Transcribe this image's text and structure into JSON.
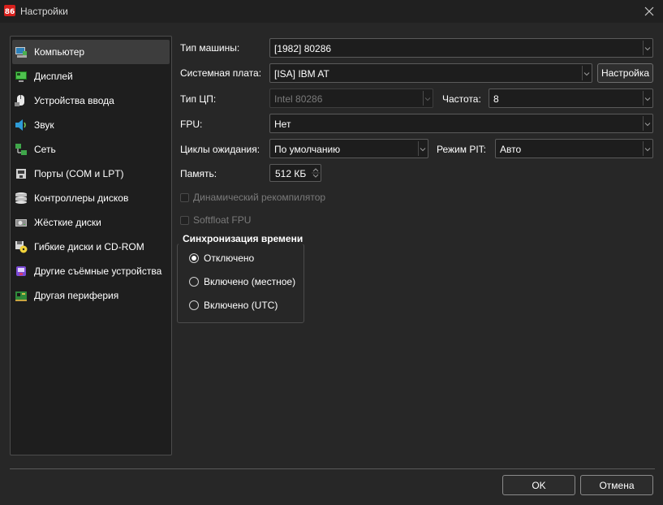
{
  "window": {
    "title": "Настройки",
    "app_icon": "86box-icon",
    "close_icon": "close-icon"
  },
  "sidebar": {
    "items": [
      {
        "label": "Компьютер",
        "icon": "computer-icon",
        "selected": true
      },
      {
        "label": "Дисплей",
        "icon": "display-icon"
      },
      {
        "label": "Устройства ввода",
        "icon": "input-devices-icon"
      },
      {
        "label": "Звук",
        "icon": "sound-icon"
      },
      {
        "label": "Сеть",
        "icon": "network-icon"
      },
      {
        "label": "Порты (COM и LPT)",
        "icon": "ports-icon"
      },
      {
        "label": "Контроллеры дисков",
        "icon": "storage-controllers-icon"
      },
      {
        "label": "Жёсткие диски",
        "icon": "hard-disk-icon"
      },
      {
        "label": "Гибкие диски и CD-ROM",
        "icon": "floppy-cdrom-icon"
      },
      {
        "label": "Другие съёмные устройства",
        "icon": "removable-devices-icon"
      },
      {
        "label": "Другая периферия",
        "icon": "other-peripherals-icon"
      }
    ]
  },
  "machine": {
    "machine_type_label": "Тип машины:",
    "machine_type_value": "[1982] 80286",
    "board_label": "Системная плата:",
    "board_value": "[ISA] IBM AT",
    "configure_button": "Настройка",
    "cpu_label": "Тип ЦП:",
    "cpu_value": "Intel 80286",
    "freq_label": "Частота:",
    "freq_value": "8",
    "fpu_label": "FPU:",
    "fpu_value": "Нет",
    "wait_label": "Циклы ожидания:",
    "wait_value": "По умолчанию",
    "pit_label": "Режим PIT:",
    "pit_value": "Авто",
    "memory_label": "Память:",
    "memory_value": "512 КБ",
    "dynarec_label": "Динамический рекомпилятор",
    "dynarec_checked": false,
    "softfloat_label": "Softfloat FPU",
    "softfloat_checked": false
  },
  "time_sync": {
    "title": "Синхронизация времени",
    "options": [
      {
        "label": "Отключено",
        "selected": true
      },
      {
        "label": "Включено (местное)",
        "selected": false
      },
      {
        "label": "Включено (UTC)",
        "selected": false
      }
    ]
  },
  "buttons": {
    "ok": "OK",
    "cancel": "Отмена"
  }
}
